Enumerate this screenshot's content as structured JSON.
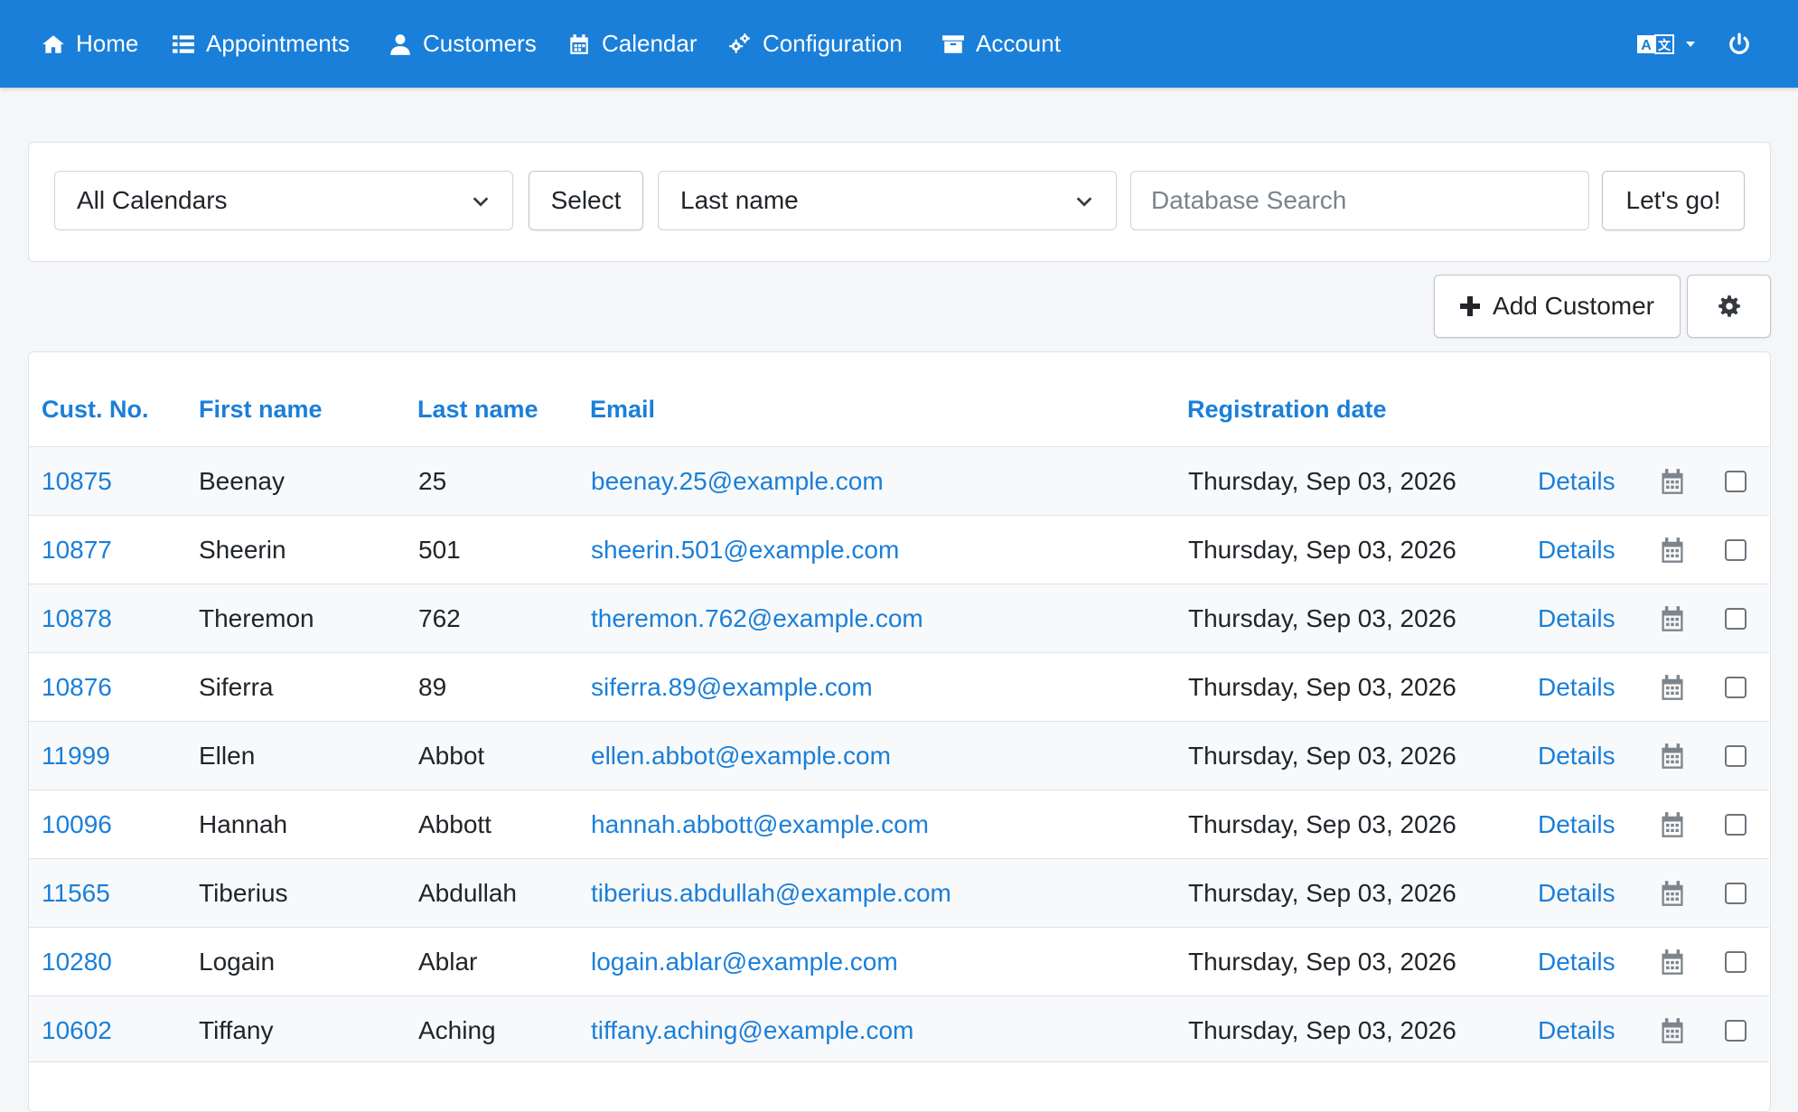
{
  "nav": {
    "items": [
      {
        "label": "Home",
        "icon": "home-icon"
      },
      {
        "label": "Appointments",
        "icon": "list-icon"
      },
      {
        "label": "Customers",
        "icon": "user-icon"
      },
      {
        "label": "Calendar",
        "icon": "calendar-icon"
      },
      {
        "label": "Configuration",
        "icon": "gears-icon"
      },
      {
        "label": "Account",
        "icon": "archive-icon"
      }
    ],
    "language_icon": "language-icon",
    "power_icon": "power-icon",
    "bar_color": "#1a7fd9"
  },
  "filters": {
    "calendar_select": "All Calendars",
    "select_button": "Select",
    "field_select": "Last name",
    "search_placeholder": "Database Search",
    "search_value": "",
    "go_button": "Let's go!"
  },
  "actions": {
    "add_customer": "Add Customer",
    "settings_icon": "gear-icon"
  },
  "table": {
    "headers": {
      "cust_no": "Cust. No.",
      "first_name": "First name",
      "last_name": "Last name",
      "email": "Email",
      "registration_date": "Registration date"
    },
    "rows": [
      {
        "cust_no": "10875",
        "first": "Beenay",
        "last": "25",
        "email": "beenay.25@example.com",
        "date": "Thursday, Sep 03, 2026",
        "details": "Details"
      },
      {
        "cust_no": "10877",
        "first": "Sheerin",
        "last": "501",
        "email": "sheerin.501@example.com",
        "date": "Thursday, Sep 03, 2026",
        "details": "Details"
      },
      {
        "cust_no": "10878",
        "first": "Theremon",
        "last": "762",
        "email": "theremon.762@example.com",
        "date": "Thursday, Sep 03, 2026",
        "details": "Details"
      },
      {
        "cust_no": "10876",
        "first": "Siferra",
        "last": "89",
        "email": "siferra.89@example.com",
        "date": "Thursday, Sep 03, 2026",
        "details": "Details"
      },
      {
        "cust_no": "11999",
        "first": "Ellen",
        "last": "Abbot",
        "email": "ellen.abbot@example.com",
        "date": "Thursday, Sep 03, 2026",
        "details": "Details"
      },
      {
        "cust_no": "10096",
        "first": "Hannah",
        "last": "Abbott",
        "email": "hannah.abbott@example.com",
        "date": "Thursday, Sep 03, 2026",
        "details": "Details"
      },
      {
        "cust_no": "11565",
        "first": "Tiberius",
        "last": "Abdullah",
        "email": "tiberius.abdullah@example.com",
        "date": "Thursday, Sep 03, 2026",
        "details": "Details"
      },
      {
        "cust_no": "10280",
        "first": "Logain",
        "last": "Ablar",
        "email": "logain.ablar@example.com",
        "date": "Thursday, Sep 03, 2026",
        "details": "Details"
      },
      {
        "cust_no": "10602",
        "first": "Tiffany",
        "last": "Aching",
        "email": "tiffany.aching@example.com",
        "date": "Thursday, Sep 03, 2026",
        "details": "Details"
      }
    ]
  }
}
